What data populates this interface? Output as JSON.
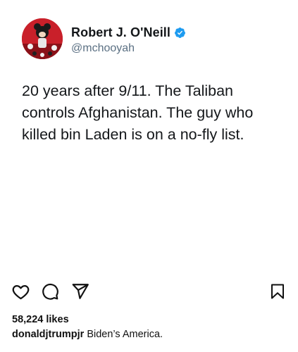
{
  "tweet": {
    "author": {
      "display_name": "Robert J. O'Neill",
      "handle": "@mchooyah",
      "verified": true,
      "verified_icon": "verified-badge-icon",
      "avatar_icon": "profile-avatar"
    },
    "text_lines": [
      "20 years after 9/11. The Taliban",
      "controls Afghanistan. The guy who",
      "killed bin Laden is on a no-fly list."
    ]
  },
  "post": {
    "actions": [
      {
        "name": "like-button",
        "icon": "heart-icon"
      },
      {
        "name": "comment-button",
        "icon": "comment-icon"
      },
      {
        "name": "share-button",
        "icon": "send-icon"
      },
      {
        "name": "save-button",
        "icon": "bookmark-icon"
      }
    ],
    "likes": "58,224 likes",
    "caption": {
      "username": "donaldjtrumpjr",
      "text": "Biden’s America."
    }
  },
  "colors": {
    "verified": "#1d9bf0",
    "handle": "#5b7083",
    "text": "#14171a",
    "avatar_bg": "#c9202a"
  }
}
